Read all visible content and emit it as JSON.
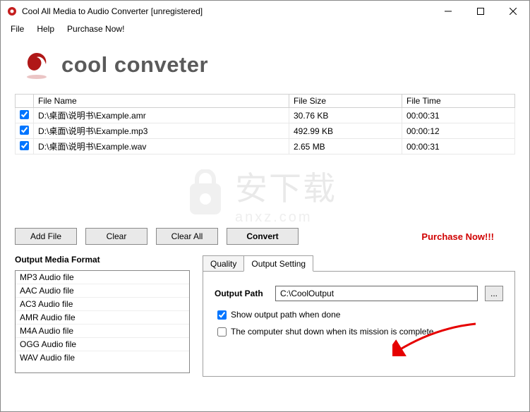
{
  "window": {
    "title": "Cool All Media to Audio Converter  [unregistered]"
  },
  "menu": {
    "file": "File",
    "help": "Help",
    "purchase": "Purchase Now!"
  },
  "logo": {
    "text": "cool conveter"
  },
  "table": {
    "headers": {
      "name": "File Name",
      "size": "File Size",
      "time": "File Time"
    },
    "rows": [
      {
        "checked": true,
        "name": "D:\\桌面\\说明书\\Example.amr",
        "size": "30.76 KB",
        "time": "00:00:31"
      },
      {
        "checked": true,
        "name": "D:\\桌面\\说明书\\Example.mp3",
        "size": "492.99 KB",
        "time": "00:00:12"
      },
      {
        "checked": true,
        "name": "D:\\桌面\\说明书\\Example.wav",
        "size": "2.65 MB",
        "time": "00:00:31"
      }
    ]
  },
  "buttons": {
    "add": "Add File",
    "clear": "Clear",
    "clearAll": "Clear All",
    "convert": "Convert"
  },
  "purchaseNow": "Purchase Now!!!",
  "format": {
    "title": "Output Media Format",
    "items": [
      "MP3 Audio file",
      "AAC Audio file",
      "AC3 Audio file",
      "AMR Audio file",
      "M4A Audio file",
      "OGG Audio file",
      "WAV Audio file"
    ]
  },
  "tabs": {
    "quality": "Quality",
    "output": "Output Setting"
  },
  "output": {
    "pathLabel": "Output Path",
    "pathValue": "C:\\CoolOutput",
    "browse": "...",
    "showPath": "Show output path when done",
    "shutdown": "The computer shut down when its mission is complete"
  },
  "watermark": {
    "text": "安下载",
    "sub": "anxz.com"
  }
}
